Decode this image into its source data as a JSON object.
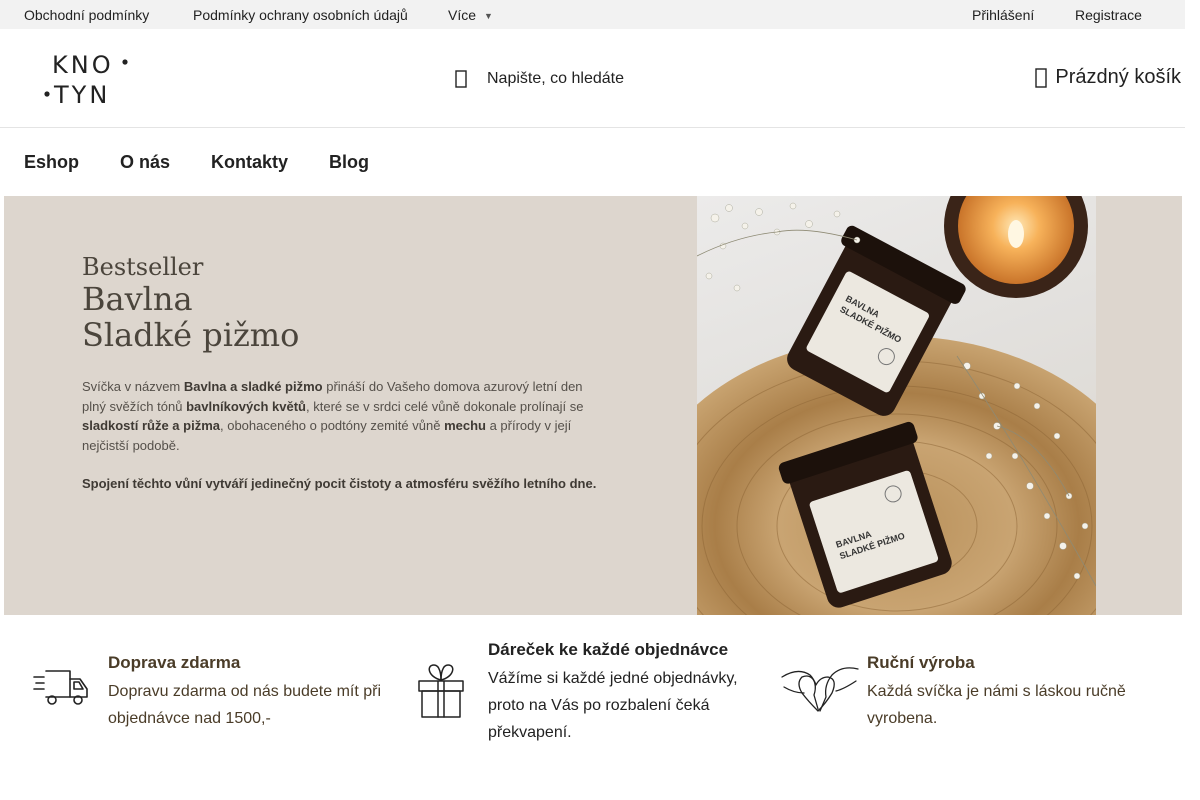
{
  "topbar": {
    "links": [
      "Obchodní podmínky",
      "Podmínky ochrany osobních údajů",
      "Více"
    ],
    "account": [
      "Přihlášení",
      "Registrace"
    ]
  },
  "header": {
    "logo_line1": "KNO",
    "logo_line2": "TYN",
    "search_placeholder": "Napište, co hledáte",
    "cart_label": "Prázdný košík"
  },
  "nav": {
    "items": [
      "Eshop",
      "O nás",
      "Kontakty",
      "Blog"
    ]
  },
  "hero": {
    "kicker": "Bestseller",
    "title_line1": "Bavlna",
    "title_line2": "Sladké pižmo",
    "desc": {
      "t1": "Svíčka v názvem ",
      "b1": "Bavlna a sladké pižmo",
      "t2": " přináší do Vašeho domova azurový letní den plný svěžích tónů ",
      "b2": "bavlníkových květů",
      "t3": ", které se v srdci celé vůně dokonale prolínají se ",
      "b3": "sladkostí růže a pižma",
      "t4": ", obohaceného o podtóny zemité vůně ",
      "b4": "mechu",
      "t5": " a přírody v její nejčistší podobě."
    },
    "desc2": "Spojení těchto vůní vytváří jedinečný pocit čistoty a atmosféru svěžího letního dne.",
    "jar_label_line1": "BAVLNA",
    "jar_label_line2": "SLADKÉ PIŽMO"
  },
  "features": [
    {
      "title": "Doprava zdarma",
      "text": "Dopravu zdarma od nás budete mít při objednávce nad 1500,-",
      "icon": "delivery-truck-icon"
    },
    {
      "title": "Dáreček ke každé objednávce",
      "text": "Vážíme si každé jedné objednávky, proto na Vás po rozbalení čeká překvapení.",
      "icon": "gift-icon"
    },
    {
      "title": "Ruční výroba",
      "text": "Každá svíčka je námi s láskou ručně vyrobena.",
      "icon": "heart-hands-icon"
    }
  ],
  "colors": {
    "banner_bg": "#ddd6ce",
    "feature_text": "#4a3c28",
    "topbar_bg": "#f2f2f2"
  }
}
